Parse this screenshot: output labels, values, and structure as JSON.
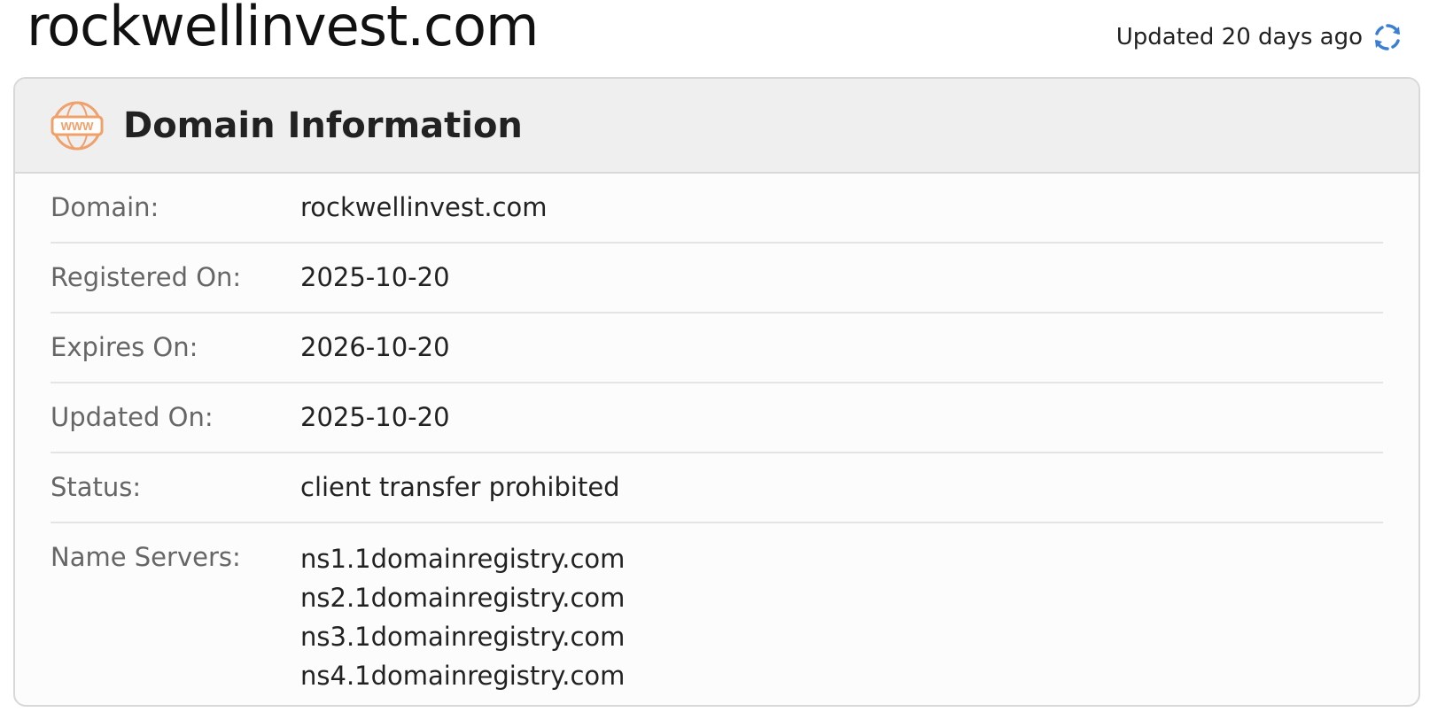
{
  "site": {
    "title": "rockwellinvest.com"
  },
  "updated": {
    "text": "Updated 20 days ago",
    "refresh_icon": "refresh-icon"
  },
  "card": {
    "icon": "www-icon",
    "title": "Domain Information",
    "rows": [
      {
        "label": "Domain:",
        "value": "rockwellinvest.com"
      },
      {
        "label": "Registered On:",
        "value": "2025-10-20"
      },
      {
        "label": "Expires On:",
        "value": "2026-10-20"
      },
      {
        "label": "Updated On:",
        "value": "2025-10-20"
      },
      {
        "label": "Status:",
        "value": "client transfer prohibited"
      }
    ],
    "name_servers": {
      "label": "Name Servers:",
      "values": [
        "ns1.1domainregistry.com",
        "ns2.1domainregistry.com",
        "ns3.1domainregistry.com",
        "ns4.1domainregistry.com"
      ]
    }
  },
  "colors": {
    "accent_orange": "#f0a06a",
    "refresh_blue": "#3b7fd4"
  }
}
